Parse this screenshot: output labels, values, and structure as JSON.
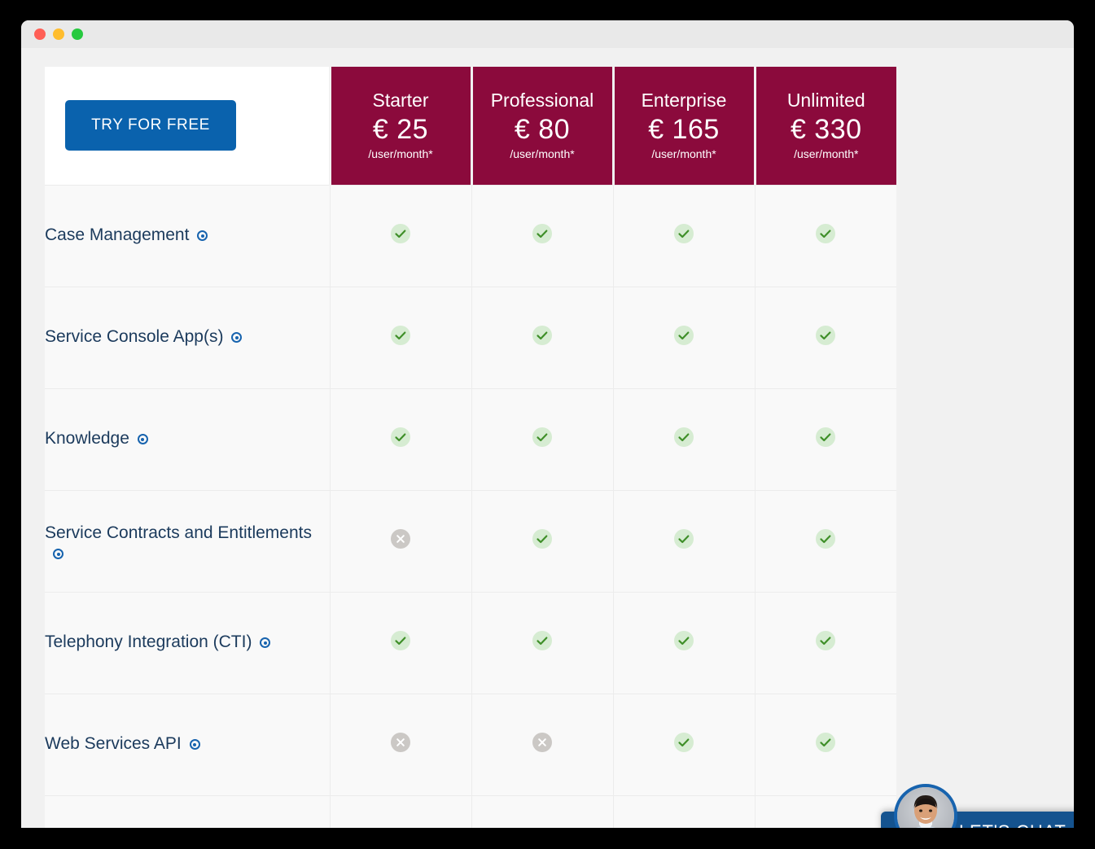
{
  "window": {
    "traffic_lights": [
      "close-red",
      "minimize-yellow",
      "maximize-green"
    ]
  },
  "colors": {
    "header_maroon": "#8b0a3c",
    "cta_blue": "#0a62ad",
    "chat_blue": "#15538f",
    "label_navy": "#1b3a5c",
    "check_green": "#3f8f29",
    "check_bg": "#d6ecd2",
    "cross_grey": "#cbc8c5",
    "page_bg": "#f1f1f1"
  },
  "cta": {
    "label": "TRY FOR FREE"
  },
  "plans": [
    {
      "name": "Starter",
      "price": "€ 25",
      "unit": "/user/month*"
    },
    {
      "name": "Professional",
      "price": "€ 80",
      "unit": "/user/month*"
    },
    {
      "name": "Enterprise",
      "price": "€ 165",
      "unit": "/user/month*"
    },
    {
      "name": "Unlimited",
      "price": "€ 330",
      "unit": "/user/month*"
    }
  ],
  "features": [
    {
      "label": "Case Management",
      "info_icon": "info-dot-icon",
      "availability": [
        "yes",
        "yes",
        "yes",
        "yes"
      ]
    },
    {
      "label": "Service Console App(s)",
      "info_icon": "info-dot-icon",
      "availability": [
        "yes",
        "yes",
        "yes",
        "yes"
      ]
    },
    {
      "label": "Knowledge",
      "info_icon": "info-dot-icon",
      "availability": [
        "yes",
        "yes",
        "yes",
        "yes"
      ]
    },
    {
      "label": "Service Contracts and Entitlements",
      "info_icon": "info-dot-icon",
      "availability": [
        "no",
        "yes",
        "yes",
        "yes"
      ]
    },
    {
      "label": "Telephony Integration (CTI)",
      "info_icon": "info-dot-icon",
      "availability": [
        "yes",
        "yes",
        "yes",
        "yes"
      ]
    },
    {
      "label": "Web Services API",
      "info_icon": "info-dot-icon",
      "availability": [
        "no",
        "no",
        "yes",
        "yes"
      ]
    },
    {
      "label": "",
      "info_icon": "",
      "availability": [
        "",
        "",
        "",
        ""
      ]
    }
  ],
  "chat": {
    "label": "LET'S CHAT",
    "avatar": "agent-photo-avatar"
  }
}
